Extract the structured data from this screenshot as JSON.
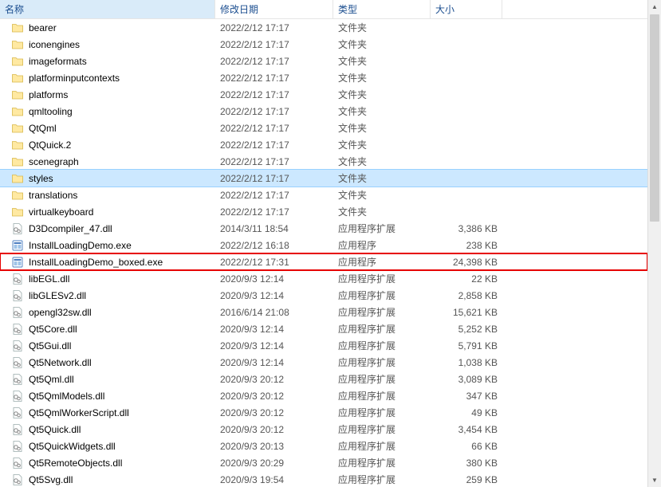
{
  "columns": {
    "name": "名称",
    "date": "修改日期",
    "type": "类型",
    "size": "大小"
  },
  "rows": [
    {
      "icon": "folder",
      "name": "bearer",
      "date": "2022/2/12 17:17",
      "type": "文件夹",
      "size": ""
    },
    {
      "icon": "folder",
      "name": "iconengines",
      "date": "2022/2/12 17:17",
      "type": "文件夹",
      "size": ""
    },
    {
      "icon": "folder",
      "name": "imageformats",
      "date": "2022/2/12 17:17",
      "type": "文件夹",
      "size": ""
    },
    {
      "icon": "folder",
      "name": "platforminputcontexts",
      "date": "2022/2/12 17:17",
      "type": "文件夹",
      "size": ""
    },
    {
      "icon": "folder",
      "name": "platforms",
      "date": "2022/2/12 17:17",
      "type": "文件夹",
      "size": ""
    },
    {
      "icon": "folder",
      "name": "qmltooling",
      "date": "2022/2/12 17:17",
      "type": "文件夹",
      "size": ""
    },
    {
      "icon": "folder",
      "name": "QtQml",
      "date": "2022/2/12 17:17",
      "type": "文件夹",
      "size": ""
    },
    {
      "icon": "folder",
      "name": "QtQuick.2",
      "date": "2022/2/12 17:17",
      "type": "文件夹",
      "size": ""
    },
    {
      "icon": "folder",
      "name": "scenegraph",
      "date": "2022/2/12 17:17",
      "type": "文件夹",
      "size": ""
    },
    {
      "icon": "folder",
      "name": "styles",
      "date": "2022/2/12 17:17",
      "type": "文件夹",
      "size": "",
      "selected": true
    },
    {
      "icon": "folder",
      "name": "translations",
      "date": "2022/2/12 17:17",
      "type": "文件夹",
      "size": ""
    },
    {
      "icon": "folder",
      "name": "virtualkeyboard",
      "date": "2022/2/12 17:17",
      "type": "文件夹",
      "size": ""
    },
    {
      "icon": "dll",
      "name": "D3Dcompiler_47.dll",
      "date": "2014/3/11 18:54",
      "type": "应用程序扩展",
      "size": "3,386 KB"
    },
    {
      "icon": "exe",
      "name": "InstallLoadingDemo.exe",
      "date": "2022/2/12 16:18",
      "type": "应用程序",
      "size": "238 KB"
    },
    {
      "icon": "exe",
      "name": "InstallLoadingDemo_boxed.exe",
      "date": "2022/2/12 17:31",
      "type": "应用程序",
      "size": "24,398 KB",
      "highlighted": true
    },
    {
      "icon": "dll",
      "name": "libEGL.dll",
      "date": "2020/9/3 12:14",
      "type": "应用程序扩展",
      "size": "22 KB"
    },
    {
      "icon": "dll",
      "name": "libGLESv2.dll",
      "date": "2020/9/3 12:14",
      "type": "应用程序扩展",
      "size": "2,858 KB"
    },
    {
      "icon": "dll",
      "name": "opengl32sw.dll",
      "date": "2016/6/14 21:08",
      "type": "应用程序扩展",
      "size": "15,621 KB"
    },
    {
      "icon": "dll",
      "name": "Qt5Core.dll",
      "date": "2020/9/3 12:14",
      "type": "应用程序扩展",
      "size": "5,252 KB"
    },
    {
      "icon": "dll",
      "name": "Qt5Gui.dll",
      "date": "2020/9/3 12:14",
      "type": "应用程序扩展",
      "size": "5,791 KB"
    },
    {
      "icon": "dll",
      "name": "Qt5Network.dll",
      "date": "2020/9/3 12:14",
      "type": "应用程序扩展",
      "size": "1,038 KB"
    },
    {
      "icon": "dll",
      "name": "Qt5Qml.dll",
      "date": "2020/9/3 20:12",
      "type": "应用程序扩展",
      "size": "3,089 KB"
    },
    {
      "icon": "dll",
      "name": "Qt5QmlModels.dll",
      "date": "2020/9/3 20:12",
      "type": "应用程序扩展",
      "size": "347 KB"
    },
    {
      "icon": "dll",
      "name": "Qt5QmlWorkerScript.dll",
      "date": "2020/9/3 20:12",
      "type": "应用程序扩展",
      "size": "49 KB"
    },
    {
      "icon": "dll",
      "name": "Qt5Quick.dll",
      "date": "2020/9/3 20:12",
      "type": "应用程序扩展",
      "size": "3,454 KB"
    },
    {
      "icon": "dll",
      "name": "Qt5QuickWidgets.dll",
      "date": "2020/9/3 20:13",
      "type": "应用程序扩展",
      "size": "66 KB"
    },
    {
      "icon": "dll",
      "name": "Qt5RemoteObjects.dll",
      "date": "2020/9/3 20:29",
      "type": "应用程序扩展",
      "size": "380 KB"
    },
    {
      "icon": "dll",
      "name": "Qt5Svg.dll",
      "date": "2020/9/3 19:54",
      "type": "应用程序扩展",
      "size": "259 KB"
    }
  ]
}
